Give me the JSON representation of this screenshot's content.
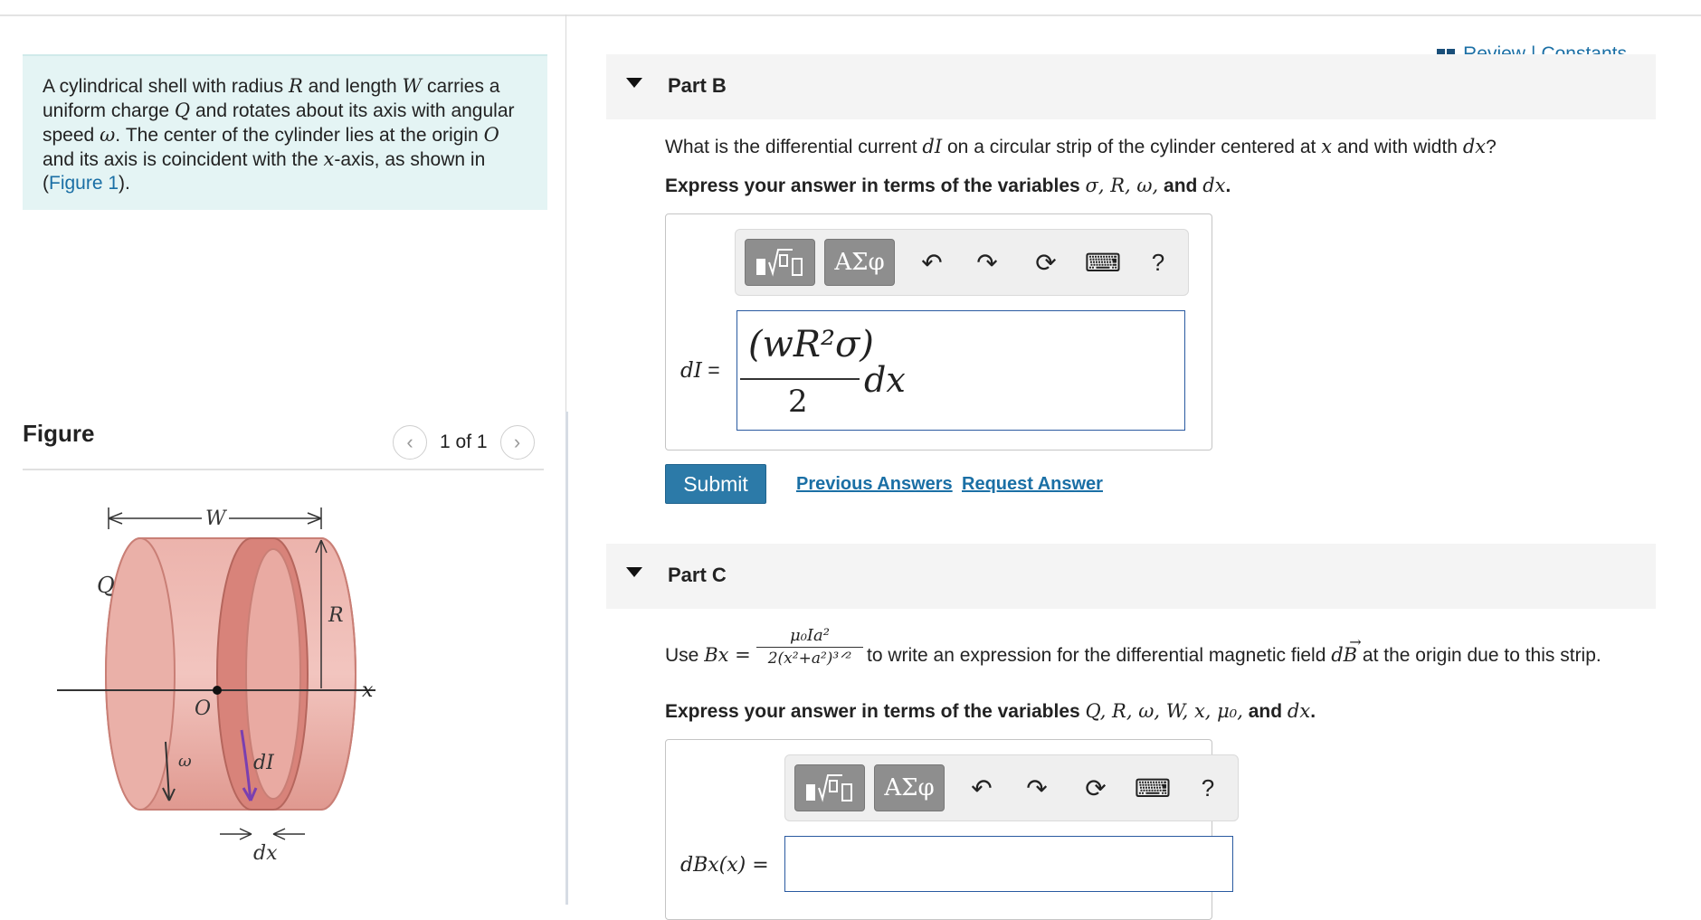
{
  "problem": {
    "t1": "A cylindrical shell with radius ",
    "R": "R",
    "t2": " and length ",
    "W": "W",
    "t3": " carries a uniform charge ",
    "Q": "Q",
    "t4": " and rotates about its axis with angular speed ",
    "omega": "ω",
    "t5": ". The center of the cylinder lies at the origin ",
    "O": "O",
    "t6": " and its axis is coincident with the ",
    "x": "x",
    "t7": "-axis, as shown in (",
    "figure_link": "Figure 1",
    "t8": ")."
  },
  "figure": {
    "title": "Figure",
    "pager": "1 of 1",
    "labels": {
      "W": "W",
      "Q": "Q",
      "R": "R",
      "x": "x",
      "O": "O",
      "omega": "ω",
      "dI": "dI",
      "dx": "dx"
    }
  },
  "header": {
    "review": "Review",
    "sep": "|",
    "constants": "Constants"
  },
  "partB": {
    "label": "Part B",
    "q1": "What is the differential current ",
    "q_dI": "dI",
    "q2": " on a circular strip of the cylinder centered at ",
    "q_x": "x",
    "q3": " and with width ",
    "q_dx": "dx",
    "q4": "?",
    "express": "Express your answer in terms of the variables ",
    "vars": "σ, R, ω,",
    "and": " and ",
    "last": "dx",
    "period": ".",
    "lhs": "dI",
    "eq": " =",
    "answer_num": "(wR²σ)",
    "answer_den": "2",
    "answer_tail": "dx",
    "submit": "Submit",
    "prev": "Previous Answers",
    "request": "Request Answer"
  },
  "partC": {
    "label": "Part C",
    "use": "Use ",
    "bx": "Bx =",
    "num": "μ₀Ia²",
    "den": "2(x²+a²)³ᐟ²",
    "rest": " to write an expression for the differential magnetic field ",
    "dB": "dB",
    "rest2": " at the origin due to this strip.",
    "express": "Express your answer in terms of the variables ",
    "vars": "Q, R, ω, W, x, μ₀,",
    "and": " and ",
    "last": "dx",
    "period": ".",
    "lhs": "dBx(x) ="
  },
  "toolbar": {
    "templates": "√",
    "greek": "ΑΣφ",
    "undo": "↶",
    "redo": "↷",
    "reset": "⟳",
    "keyboard": "⌨",
    "help": "?"
  },
  "colors": {
    "accent": "#1a6fa5",
    "submit": "#2c7aa8",
    "problem_bg": "#e4f4f4",
    "cylinder": "#e8a9a2",
    "strip_arrow": "#7a3fb0"
  }
}
